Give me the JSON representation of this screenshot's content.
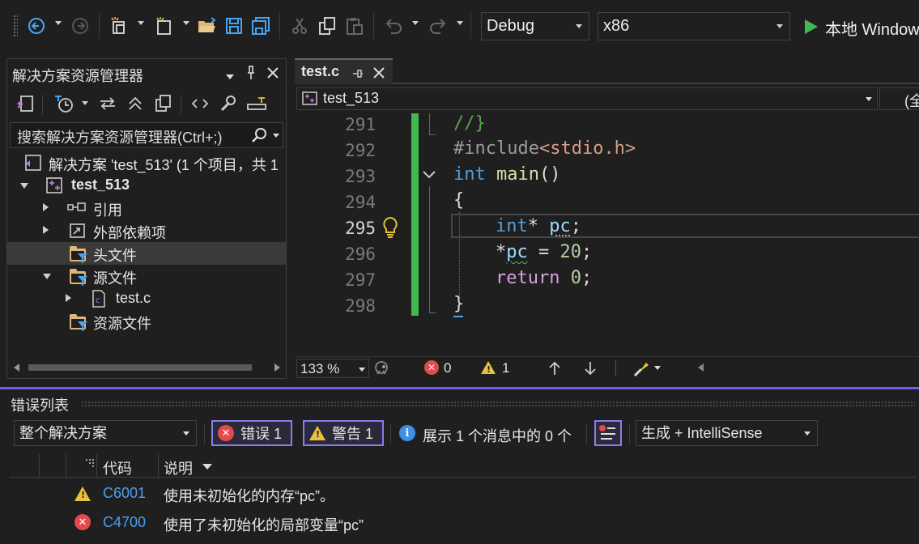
{
  "toolbar": {
    "config_value": "Debug",
    "platform_value": "x86",
    "run_label": "本地 Windows"
  },
  "solution_explorer": {
    "title": "解决方案资源管理器",
    "search_placeholder": "搜索解决方案资源管理器(Ctrl+;)",
    "tree": [
      {
        "label": "解决方案 'test_513' (1 个项目，共 1"
      },
      {
        "label": "test_513"
      },
      {
        "label": "引用"
      },
      {
        "label": "外部依赖项"
      },
      {
        "label": "头文件"
      },
      {
        "label": "源文件"
      },
      {
        "label": "test.c"
      },
      {
        "label": "资源文件"
      }
    ]
  },
  "editor": {
    "tab_label": "test.c",
    "nav_scope": "test_513",
    "nav_right": "(全",
    "lines": [
      {
        "num": "291"
      },
      {
        "num": "292"
      },
      {
        "num": "293"
      },
      {
        "num": "294"
      },
      {
        "num": "295"
      },
      {
        "num": "296"
      },
      {
        "num": "297"
      },
      {
        "num": "298"
      }
    ],
    "code": {
      "l291": "//}",
      "l292_a": "#include",
      "l292_b": "<stdio.h>",
      "l293_kw": "int",
      "l293_fn": "main",
      "l293_p": "()",
      "l294": "{",
      "l295_kw": "int",
      "l295_star": "*",
      "l295_var": "pc",
      "l295_end": ";",
      "l296_star": "*",
      "l296_var": "pc",
      "l296_op": " = ",
      "l296_num": "20",
      "l296_end": ";",
      "l297_kw": "return",
      "l297_num": "0",
      "l297_end": ";",
      "l298": "}"
    },
    "status": {
      "zoom": "133 %",
      "errors": "0",
      "warnings": "1"
    }
  },
  "error_list": {
    "title": "错误列表",
    "scope": "整个解决方案",
    "errors_btn": "错误 1",
    "warnings_btn": "警告 1",
    "messages": "展示 1 个消息中的 0 个",
    "source_filter": "生成 + IntelliSense",
    "columns": {
      "code": "代码",
      "description": "说明"
    },
    "rows": [
      {
        "severity": "warning",
        "code": "C6001",
        "description": "使用未初始化的内存“pc”。"
      },
      {
        "severity": "error",
        "code": "C4700",
        "description": "使用了未初始化的局部变量“pc”"
      }
    ]
  },
  "colors": {
    "accent": "#7160e8",
    "error": "#e5484d",
    "warning": "#e8c23c",
    "link": "#4e9ef0",
    "change_bar": "#3fb950"
  }
}
